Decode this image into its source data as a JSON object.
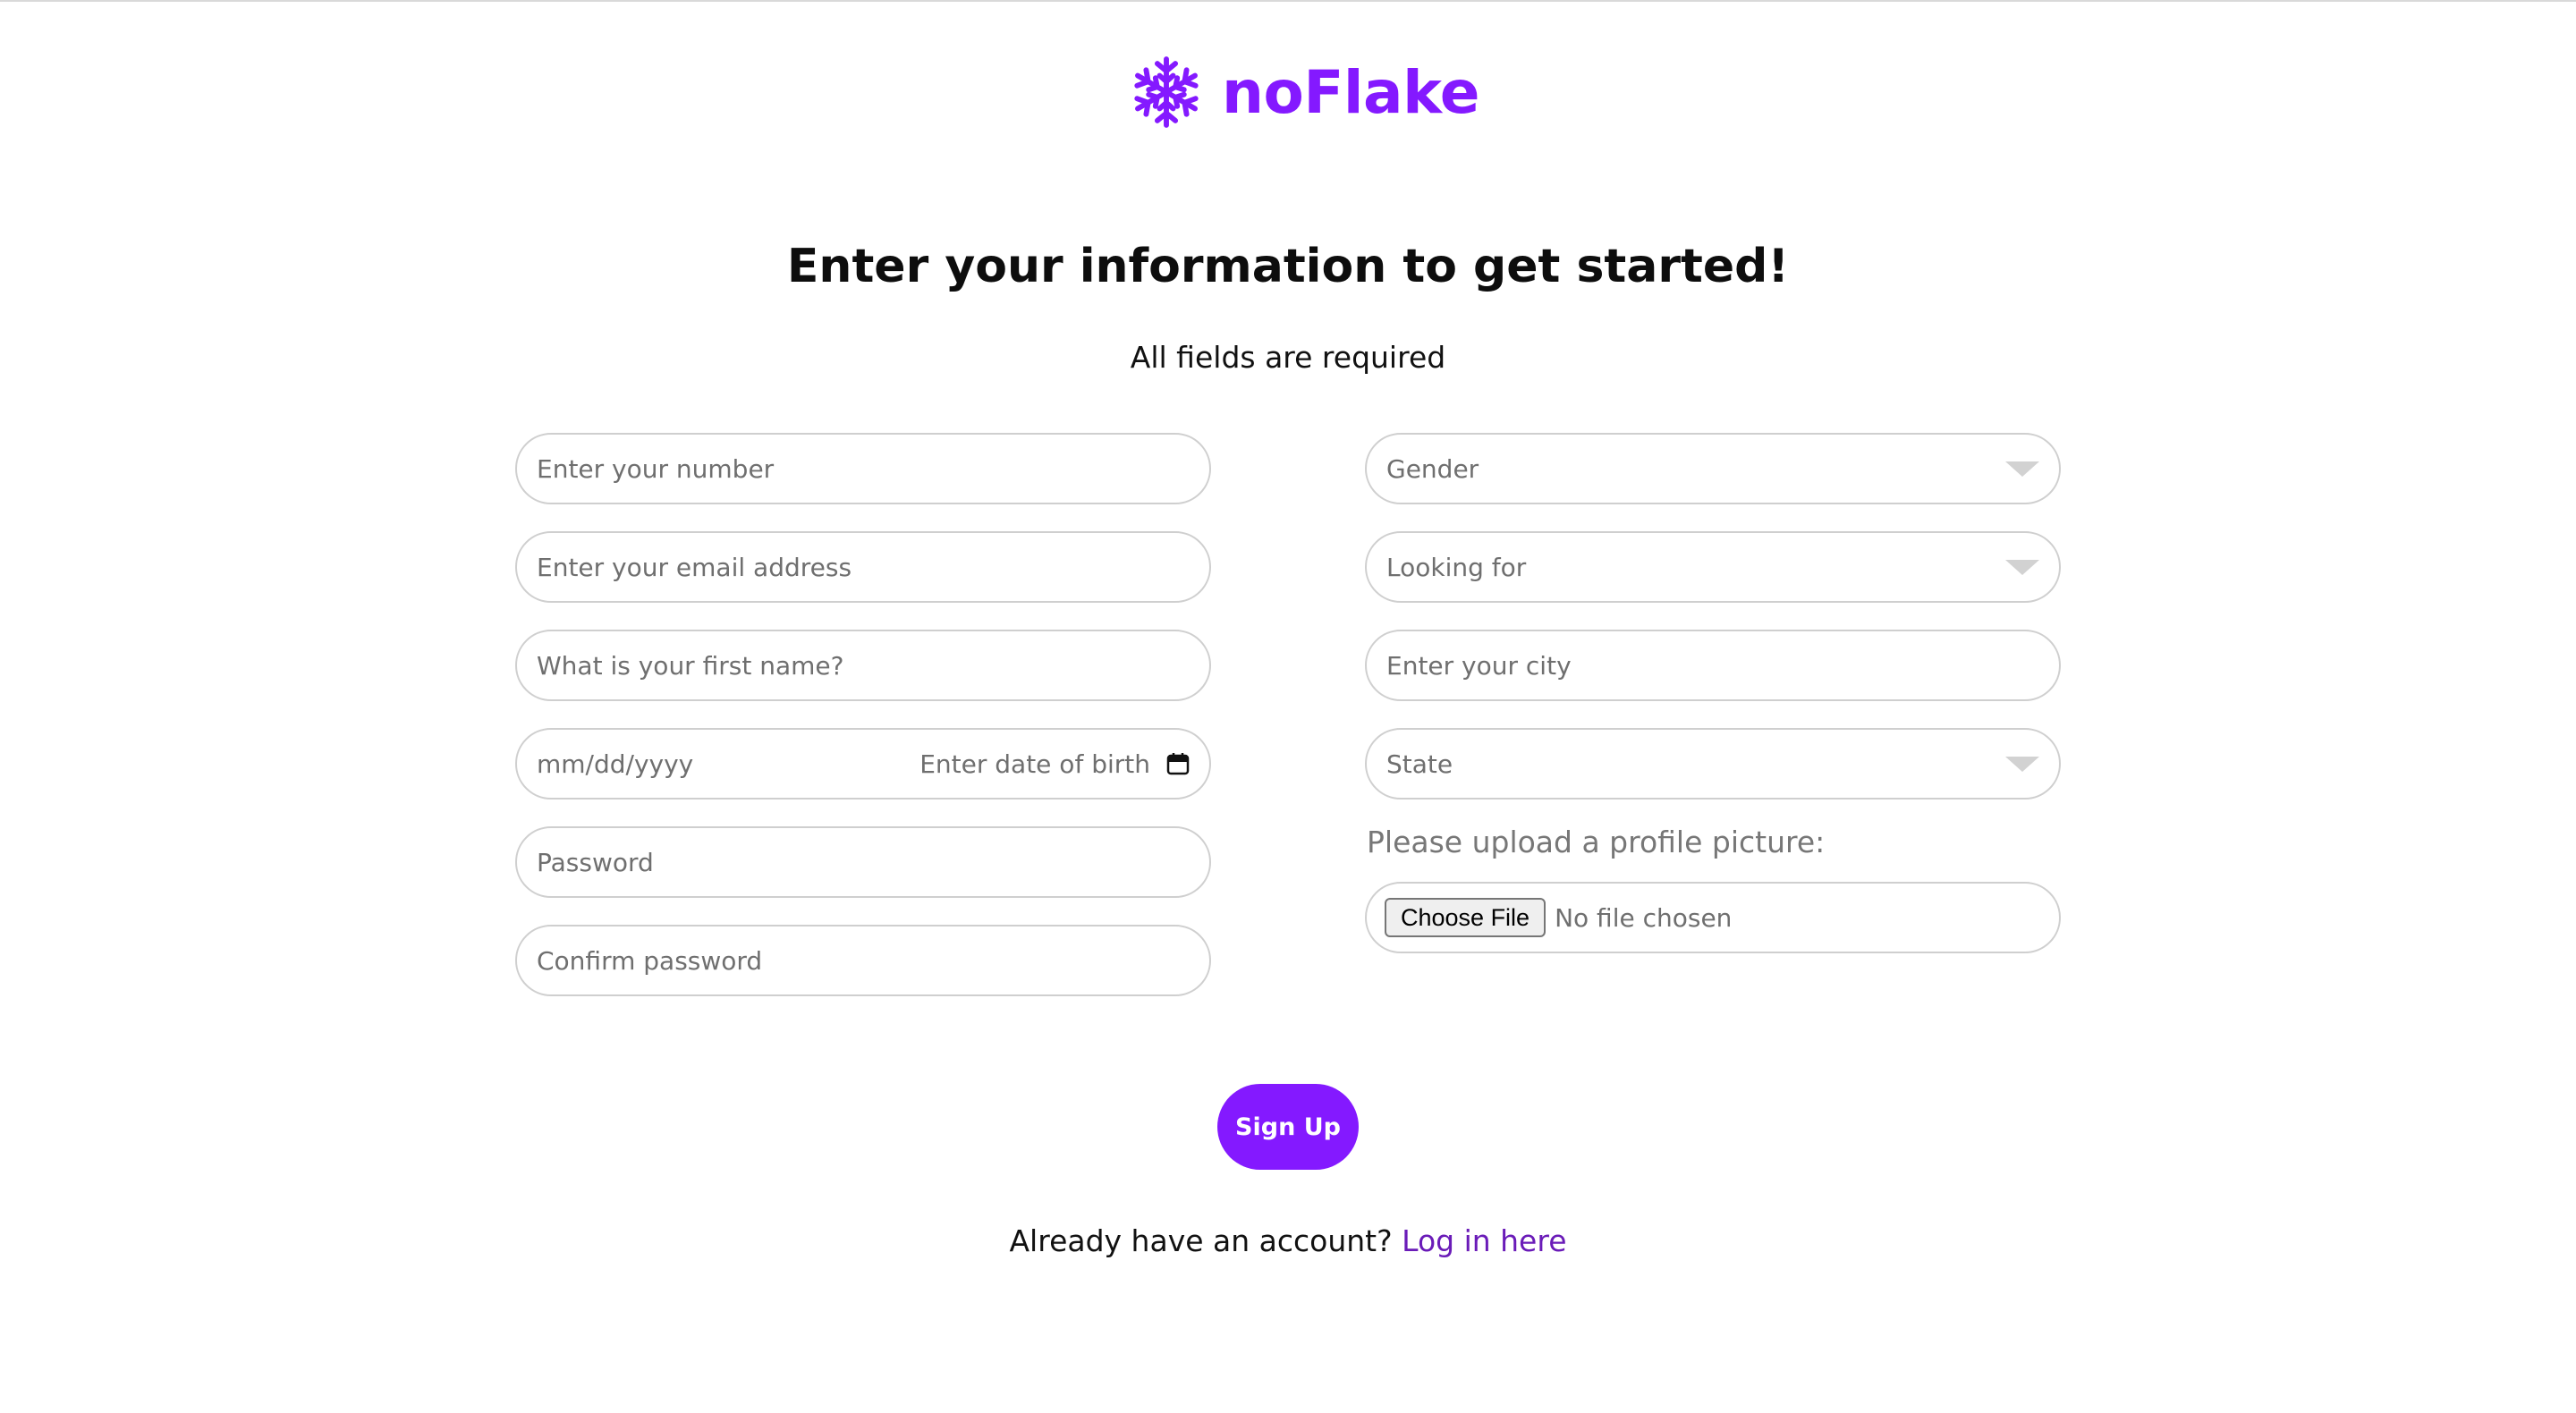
{
  "brand": {
    "name": "noFlake",
    "icon": "snowflake-icon",
    "color": "#8419ff"
  },
  "page": {
    "heading": "Enter your information to get started!",
    "subheading": "All fields are required"
  },
  "form": {
    "left": {
      "number_placeholder": "Enter your number",
      "email_placeholder": "Enter your email address",
      "first_name_placeholder": "What is your first name?",
      "dob_format": "mm/dd/yyyy",
      "dob_label": "Enter date of birth",
      "dob_icon": "calendar-icon",
      "password_placeholder": "Password",
      "confirm_password_placeholder": "Confirm password"
    },
    "right": {
      "gender_placeholder": "Gender",
      "looking_for_placeholder": "Looking for",
      "city_placeholder": "Enter your city",
      "state_placeholder": "State",
      "dropdown_icon": "caret-down-icon",
      "upload_label": "Please upload a profile picture:",
      "choose_file_label": "Choose File",
      "file_status": "No file chosen"
    }
  },
  "actions": {
    "signup_label": "Sign Up",
    "signup_color": "#8419ff",
    "login_prompt": "Already have an account?",
    "login_link": "Log in here",
    "login_link_color": "#6a1bb8"
  }
}
